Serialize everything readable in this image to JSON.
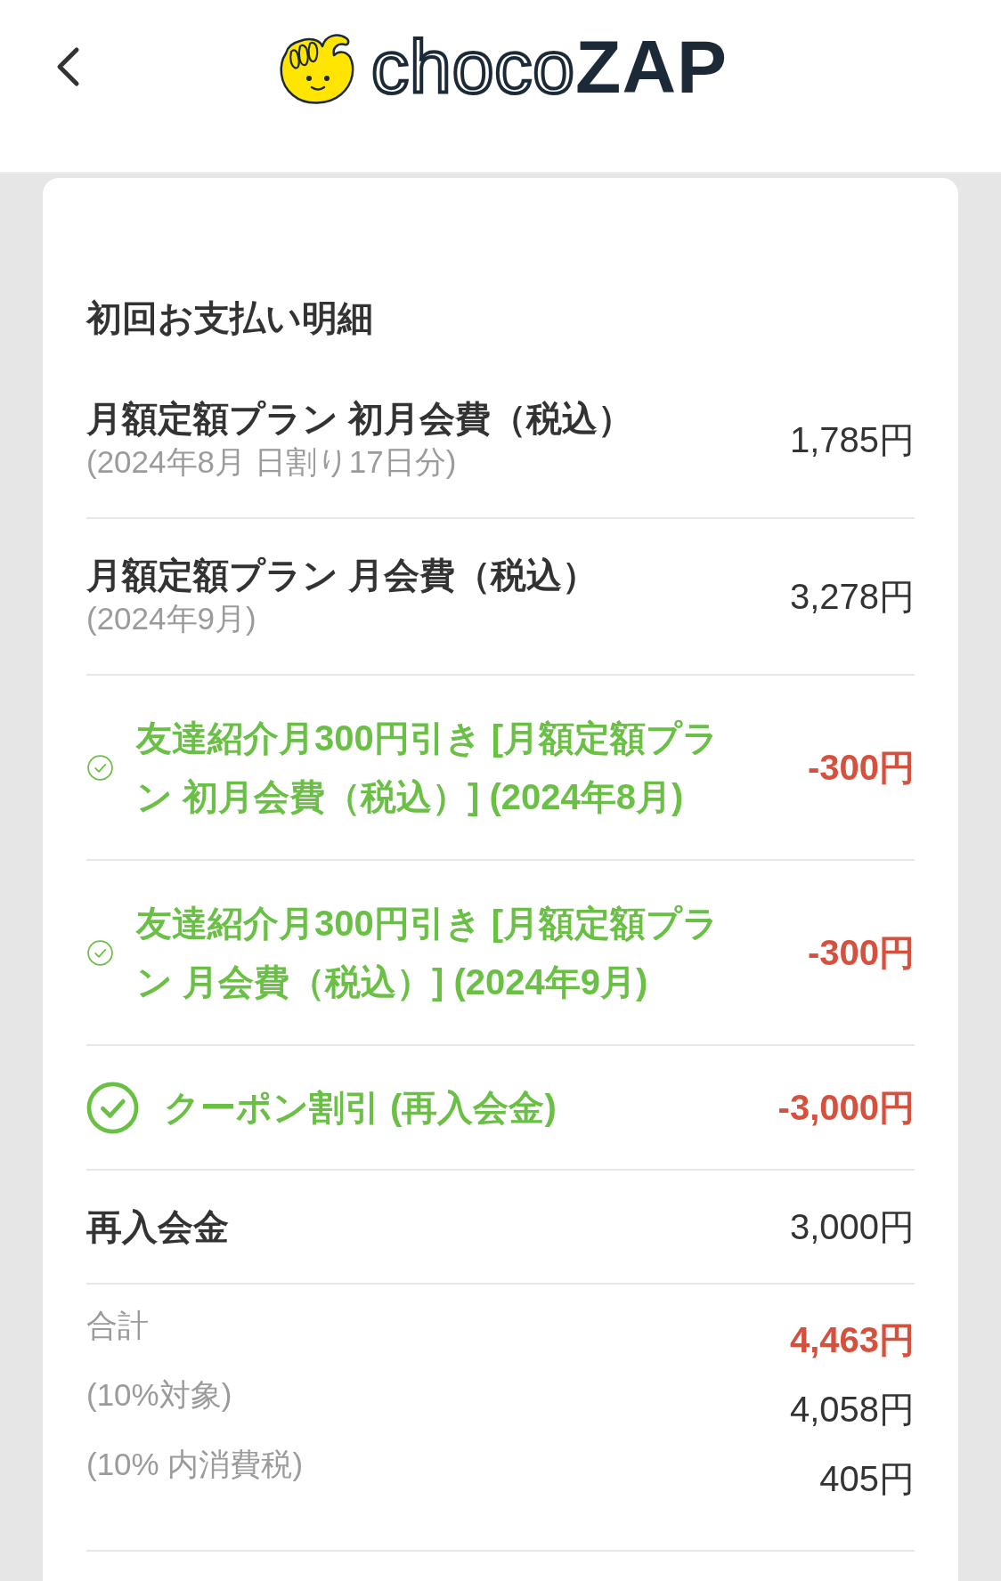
{
  "header": {
    "logo": {
      "outline_text": "choco",
      "solid_text": "ZAP"
    }
  },
  "statement": {
    "title": "初回お支払い明細",
    "items": [
      {
        "kind": "charge",
        "label": "月額定額プラン 初月会費（税込）",
        "note": "(2024年8月 日割り17日分)",
        "amount": "1,785円"
      },
      {
        "kind": "charge",
        "label": "月額定額プラン 月会費（税込）",
        "note": "(2024年9月)",
        "amount": "3,278円"
      },
      {
        "kind": "discount",
        "label": "友達紹介月300円引き [月額定額プラン 初月会費（税込）] (2024年8月)",
        "amount": "-300円"
      },
      {
        "kind": "discount",
        "label": "友達紹介月300円引き [月額定額プラン 月会費（税込）] (2024年9月)",
        "amount": "-300円"
      },
      {
        "kind": "coupon",
        "label": "クーポン割引 (再入会金)",
        "amount": "-3,000円"
      },
      {
        "kind": "charge",
        "label": "再入会金",
        "amount": "3,000円"
      }
    ],
    "totals": [
      {
        "kind": "total",
        "label": "合計",
        "amount": "4,463円"
      },
      {
        "kind": "breakdown",
        "label": "(10%対象)",
        "amount": "4,058円"
      },
      {
        "kind": "breakdown",
        "label": "(10% 内消費税)",
        "amount": "405円"
      }
    ]
  }
}
